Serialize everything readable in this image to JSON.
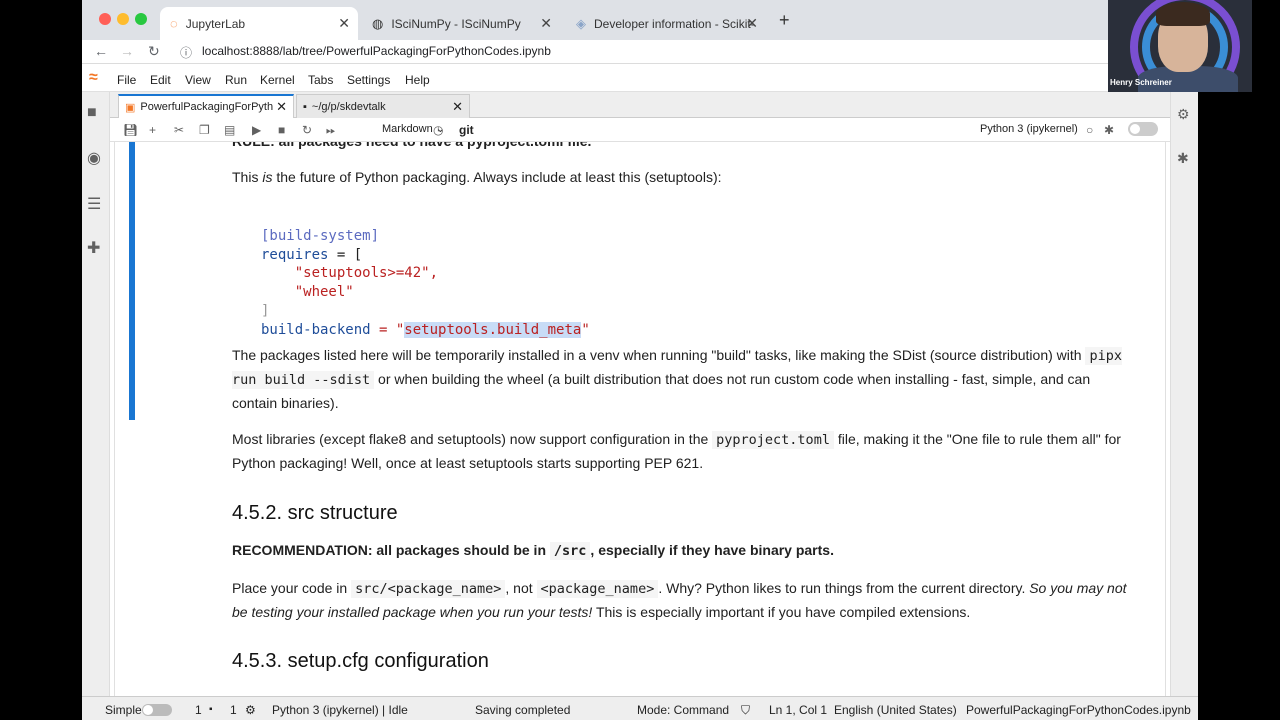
{
  "browser": {
    "tabs": [
      {
        "title": "JupyterLab",
        "icon": "jupyter-icon"
      },
      {
        "title": "ISciNumPy - ISciNumPy",
        "icon": "globe-icon"
      },
      {
        "title": "Developer information - Scikit-",
        "icon": "scikit-icon"
      }
    ],
    "url": "localhost:8888/lab/tree/PowerfulPackagingForPythonCodes.ipynb"
  },
  "menu": [
    "File",
    "Edit",
    "View",
    "Run",
    "Kernel",
    "Tabs",
    "Settings",
    "Help"
  ],
  "doc_tabs": [
    {
      "title": "PowerfulPackagingForPyth"
    },
    {
      "title": "~/g/p/skdevtalk"
    }
  ],
  "toolbar": {
    "cell_type": "Markdown",
    "git": "git",
    "kernel": "Python 3 (ipykernel)"
  },
  "notebook": {
    "cut_heading": "RULE: all packages need to have a pyproject.toml file.",
    "para1_a": "This ",
    "para1_em": "is",
    "para1_b": " the future of Python packaging. Always include at least this (setuptools):",
    "code_line1": "[build-system]",
    "code_line2_key": "requires",
    "code_line2_rest": " = [",
    "code_line3": "    \"setuptools>=42\",",
    "code_line4": "    \"wheel\"",
    "code_line5": "]",
    "code_line6_key": "build-backend",
    "code_line6_eq": " = \"",
    "code_line6_sel": "setuptools.build_meta",
    "code_line6_end": "\"",
    "para2_a": "The packages listed here will be temporarily installed in a venv when running \"build\" tasks, like making the SDist (source distribution) with",
    "para2_code": "pipx run build --sdist",
    "para2_b": " or when building the wheel (a built distribution that does not run custom code when installing - fast, simple, and can contain binaries).",
    "para3_a": "Most libraries (except flake8 and setuptools) now support configuration in the ",
    "para3_code": "pyproject.toml",
    "para3_b": " file, making it the \"One file to rule them all\" for Python packaging! Well, once at least setuptools starts supporting PEP 621.",
    "h_src": "4.5.2. src structure",
    "rec_a": "RECOMMENDATION: all packages should be in ",
    "rec_code": "/src",
    "rec_b": ", especially if they have binary parts.",
    "para4_a": "Place your code in ",
    "para4_code1": "src/<package_name>",
    "para4_mid": ", not ",
    "para4_code2": "<package_name>",
    "para4_b": ". Why? Python likes to run things from the current directory. ",
    "para4_em": "So you may not be testing your installed package when you run your tests!",
    "para4_c": " This is especially important if you have compiled extensions.",
    "h_setupcfg": "4.5.3. setup.cfg configuration"
  },
  "status": {
    "mode_label": "Simple",
    "n1": "1",
    "n2": "1",
    "kernel_state": "Python 3 (ipykernel) | Idle",
    "saving": "Saving completed",
    "mode": "Mode: Command",
    "pos": "Ln 1, Col 1",
    "lang": "English (United States)",
    "file": "PowerfulPackagingForPythonCodes.ipynb"
  },
  "webcam": {
    "name": "Henry Schreiner"
  }
}
